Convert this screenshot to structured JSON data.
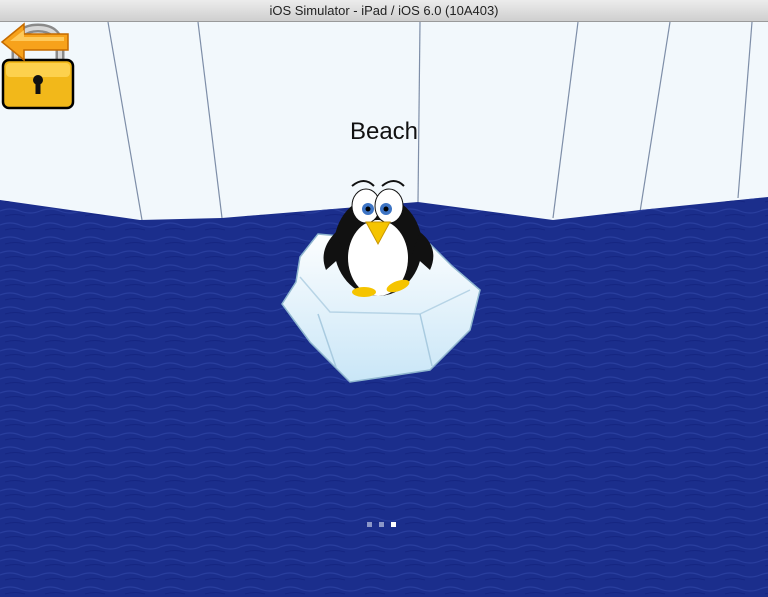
{
  "window": {
    "title": "iOS Simulator - iPad / iOS 6.0 (10A403)"
  },
  "level": {
    "name": "Beach",
    "locked": true
  },
  "pager": {
    "total": 3,
    "current": 3
  },
  "colors": {
    "water": "#1b2e8c",
    "ice": "#eef6fc",
    "lock": "#f2b81a",
    "arrow": "#f7a21b"
  },
  "icons": {
    "back": "back-arrow-icon",
    "lock": "padlock-icon",
    "character": "penguin"
  }
}
